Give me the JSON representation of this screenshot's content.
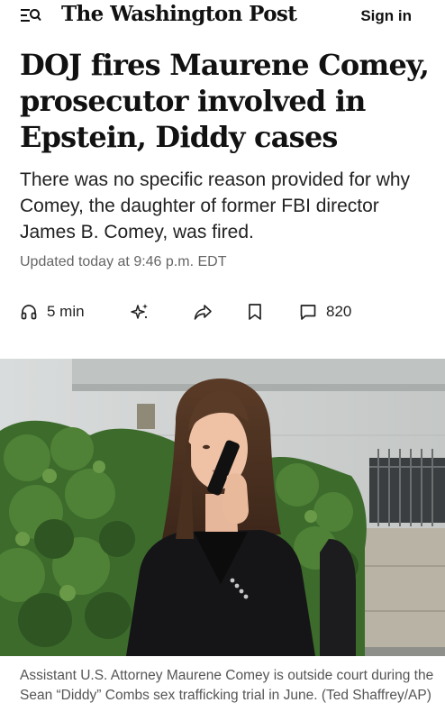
{
  "header": {
    "menu_icon": "menu-search-icon",
    "logo": "The Washington Post",
    "sign_in": "Sign in"
  },
  "article": {
    "headline": "DOJ fires Maurene Comey, prosecutor involved in Epstein, Diddy cases",
    "dek": "There was no specific reason provided for why Comey, the daughter of former FBI director James B. Comey, was fired.",
    "timestamp": "Updated today at 9:46 p.m. EDT"
  },
  "actions": {
    "listen_icon": "headphones-icon",
    "listen_label": "5 min",
    "summary_icon": "sparkle-icon",
    "share_icon": "share-icon",
    "save_icon": "bookmark-icon",
    "comments_icon": "comment-icon",
    "comment_count": "820"
  },
  "photo": {
    "caption": "Assistant U.S. Attorney Maurene Comey is outside court during the Sean “Diddy” Combs sex trafficking trial in June. (Ted Shaffrey/AP)"
  },
  "colors": {
    "text": "#111111",
    "secondary_text": "#666666",
    "caption_text": "#555555",
    "background": "#ffffff"
  }
}
